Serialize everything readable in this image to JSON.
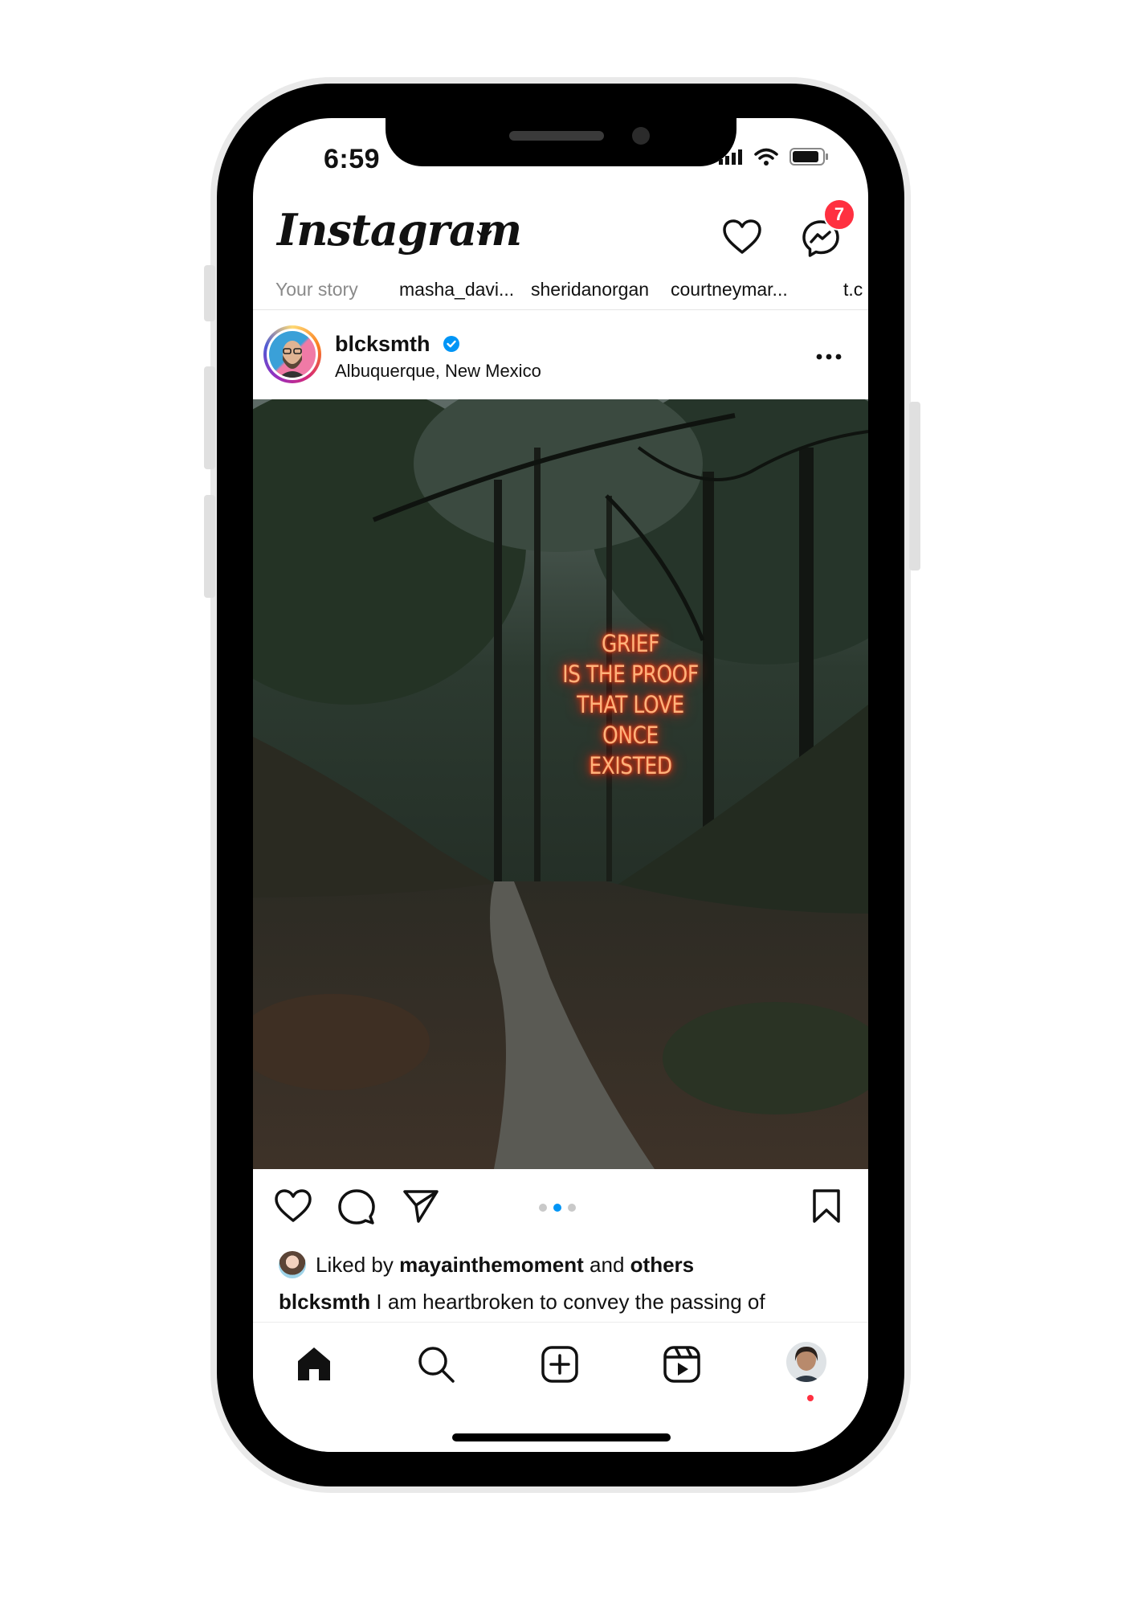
{
  "status_bar": {
    "time": "6:59"
  },
  "header": {
    "logo_text": "Instagram",
    "message_badge": "7"
  },
  "stories": [
    {
      "label": "Your story"
    },
    {
      "label": "masha_davi..."
    },
    {
      "label": "sheridanorgan"
    },
    {
      "label": "courtneymar..."
    },
    {
      "label": "t.c"
    }
  ],
  "post": {
    "username": "blcksmth",
    "location": "Albuquerque, New Mexico",
    "image_text": [
      "GRIEF",
      "IS THE PROOF",
      "THAT LOVE",
      "ONCE EXISTED"
    ],
    "carousel": {
      "count": 3,
      "active_index": 2
    },
    "likes": {
      "prefix": "Liked by",
      "user": "mayainthemoment",
      "and": "and",
      "others": "others"
    },
    "caption": {
      "user": "blcksmth",
      "text": "I am heartbroken to convey the passing of"
    }
  },
  "colors": {
    "accent": "#0095f6",
    "badge": "#ff3040",
    "neon": "#ff4a1c"
  }
}
